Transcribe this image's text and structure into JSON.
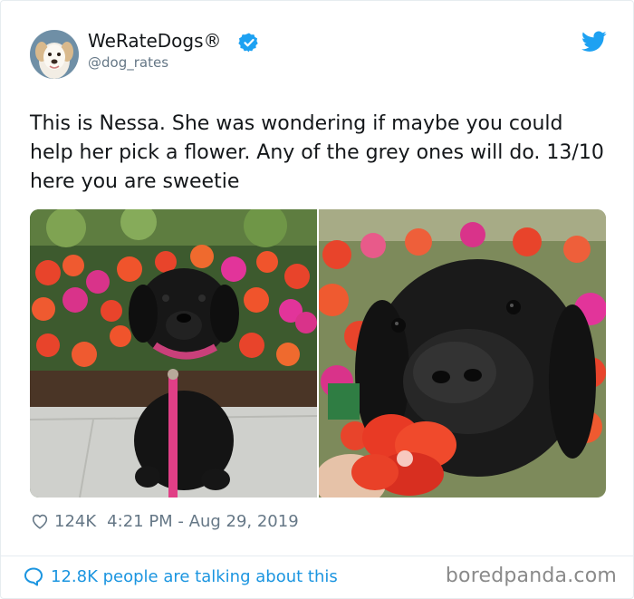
{
  "author": {
    "display_name": "WeRateDogs®",
    "handle": "@dog_rates",
    "verified": true,
    "avatar_icon": "dog-avatar-icon"
  },
  "tweet": {
    "text": "This is Nessa. She was wondering if maybe you could help her pick a flower. Any of the grey ones will do. 13/10 here you are sweetie",
    "like_count": "124K",
    "timestamp": "4:21 PM - Aug 29, 2019"
  },
  "footer": {
    "talking_text": "12.8K people are talking about this",
    "watermark": "boredpanda.com"
  },
  "colors": {
    "link_blue": "#1b95e0",
    "verified_blue": "#1da1f2",
    "muted_gray": "#657786"
  },
  "icons": [
    "verified-badge-icon",
    "twitter-bird-icon",
    "heart-icon",
    "speech-bubble-icon"
  ]
}
